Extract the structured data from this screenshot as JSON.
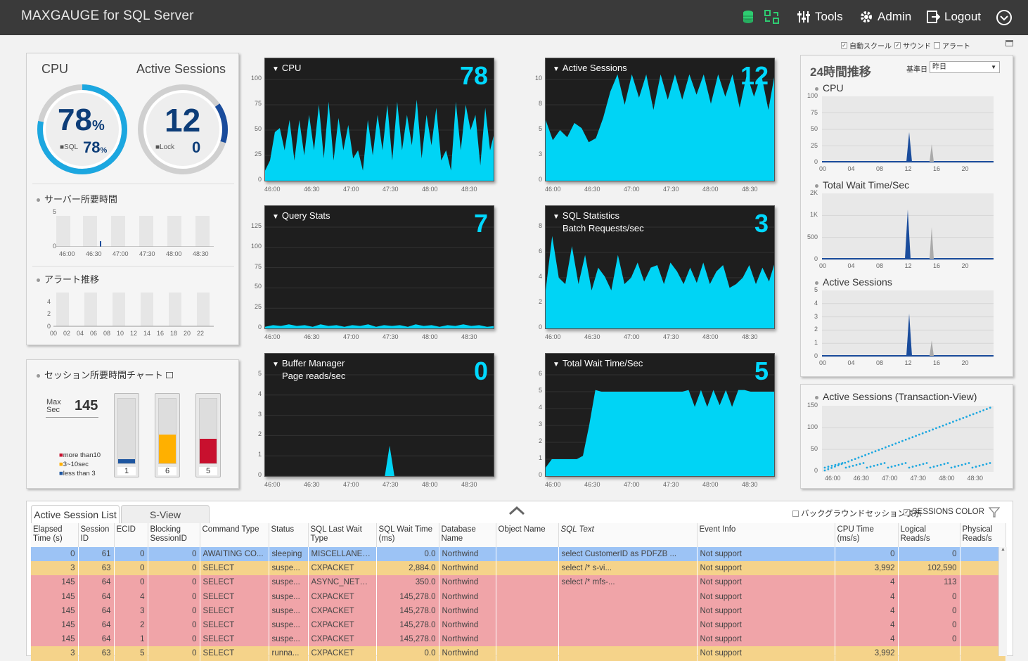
{
  "header": {
    "brand": "MAXGAUGE for SQL Server",
    "tools": "Tools",
    "admin": "Admin",
    "logout": "Logout"
  },
  "options": {
    "auto_scale": "自動スクール",
    "sound": "サウンド",
    "alert": "アラート"
  },
  "summary": {
    "cpu_label": "CPU",
    "cpu_value": "78",
    "cpu_unit": "%",
    "sql_label": "SQL",
    "sql_value": "78",
    "sql_unit": "%",
    "active_label": "Active Sessions",
    "active_value": "12",
    "lock_label": "Lock",
    "lock_value": "0",
    "server_time_title": "サーバー所要時間",
    "server_time_y": [
      "5",
      "0"
    ],
    "server_time_x": [
      "46:00",
      "46:30",
      "47:00",
      "47:30",
      "48:00",
      "48:30"
    ],
    "alert_title": "アラート推移",
    "alert_y": [
      "4",
      "2",
      "0"
    ],
    "alert_x": [
      "00",
      "02",
      "04",
      "06",
      "08",
      "10",
      "12",
      "14",
      "16",
      "18",
      "20",
      "22"
    ]
  },
  "session_chart": {
    "title": "セッション所要時間チャート",
    "max_label_1": "Max",
    "max_label_2": "Sec",
    "max_value": "145",
    "legend": [
      "more than10",
      "3~10sec",
      "less than 3"
    ],
    "bars": [
      {
        "count": "1",
        "fill": 0.06,
        "color": "#1e56a0"
      },
      {
        "count": "6",
        "fill": 0.45,
        "color": "#ffb000"
      },
      {
        "count": "5",
        "fill": 0.38,
        "color": "#c8102e"
      }
    ]
  },
  "x_axis": [
    "46:00",
    "46:30",
    "47:00",
    "47:30",
    "48:00",
    "48:30"
  ],
  "charts": {
    "cpu": {
      "title": "CPU",
      "value": "78",
      "y": [
        "100",
        "75",
        "50",
        "25",
        "0"
      ]
    },
    "active": {
      "title": "Active Sessions",
      "value": "12",
      "y": [
        "10",
        "8",
        "5",
        "3",
        "0"
      ]
    },
    "query": {
      "title": "Query Stats",
      "value": "7",
      "y": [
        "125",
        "100",
        "75",
        "50",
        "25",
        "0"
      ]
    },
    "sqlstat": {
      "title": "SQL Statistics",
      "subtitle": "Batch Requests/sec",
      "value": "3",
      "y": [
        "8",
        "6",
        "4",
        "2",
        "0"
      ]
    },
    "buffer": {
      "title": "Buffer Manager",
      "subtitle": "Page reads/sec",
      "value": "0",
      "y": [
        "5",
        "4",
        "3",
        "2",
        "1",
        "0"
      ]
    },
    "wait": {
      "title": "Total Wait Time/Sec",
      "value": "5",
      "y": [
        "6",
        "5",
        "4",
        "3",
        "2",
        "1",
        "0"
      ]
    }
  },
  "trend": {
    "title": "24時間推移",
    "base_label": "基準日",
    "base_value": "昨日",
    "x": [
      "00",
      "04",
      "08",
      "12",
      "16",
      "20"
    ],
    "cpu": {
      "title": "CPU",
      "y": [
        "100",
        "75",
        "50",
        "25",
        "0"
      ]
    },
    "wait": {
      "title": "Total Wait Time/Sec",
      "y": [
        "2K",
        "1K",
        "500",
        "0"
      ]
    },
    "active": {
      "title": "Active Sessions",
      "y": [
        "5",
        "4",
        "3",
        "2",
        "1",
        "0"
      ]
    }
  },
  "txview": {
    "title": "Active Sessions (Transaction-View)",
    "y": [
      "150",
      "100",
      "50",
      "0"
    ],
    "x": [
      "46:00",
      "46:30",
      "47:00",
      "47:30",
      "48:00",
      "48:30"
    ]
  },
  "list": {
    "tab1": "Active Session List",
    "tab2": "S-View",
    "bg_label": "バックグラウンドセッション表示",
    "color_label": "SESSIONS COLOR",
    "columns": [
      "Elapsed Time (s)",
      "Session ID",
      "ECID",
      "Blocking SessionID",
      "Command Type",
      "Status",
      "SQL Last Wait Type",
      "SQL Wait Time (ms)",
      "Database Name",
      "Object Name",
      "SQL Text",
      "Event Info",
      "CPU Time (ms/s)",
      "Logical Reads/s",
      "Physical Reads/s"
    ],
    "rows": [
      {
        "color": "#9cc3f5",
        "cells": [
          "0",
          "61",
          "0",
          "0",
          "AWAITING CO...",
          "sleeping",
          "MISCELLANEO...",
          "0.0",
          "Northwind",
          "",
          "select CustomerID as PDFZB ...",
          "Not support",
          "0",
          "0",
          ""
        ]
      },
      {
        "color": "#f5d38a",
        "cells": [
          "3",
          "63",
          "0",
          "0",
          "SELECT",
          "suspe...",
          "CXPACKET",
          "2,884.0",
          "Northwind",
          "",
          "select /* s-vi...",
          "Not support",
          "3,992",
          "102,590",
          ""
        ]
      },
      {
        "color": "#f0a4a8",
        "cells": [
          "145",
          "64",
          "0",
          "0",
          "SELECT",
          "suspe...",
          "ASYNC_NETW...",
          "350.0",
          "Northwind",
          "",
          "select /* mfs-...",
          "Not support",
          "4",
          "113",
          ""
        ]
      },
      {
        "color": "#f0a4a8",
        "cells": [
          "145",
          "64",
          "4",
          "0",
          "SELECT",
          "suspe...",
          "CXPACKET",
          "145,278.0",
          "Northwind",
          "",
          "",
          "Not support",
          "4",
          "0",
          ""
        ]
      },
      {
        "color": "#f0a4a8",
        "cells": [
          "145",
          "64",
          "3",
          "0",
          "SELECT",
          "suspe...",
          "CXPACKET",
          "145,278.0",
          "Northwind",
          "",
          "",
          "Not support",
          "4",
          "0",
          ""
        ]
      },
      {
        "color": "#f0a4a8",
        "cells": [
          "145",
          "64",
          "2",
          "0",
          "SELECT",
          "suspe...",
          "CXPACKET",
          "145,278.0",
          "Northwind",
          "",
          "",
          "Not support",
          "4",
          "0",
          ""
        ]
      },
      {
        "color": "#f0a4a8",
        "cells": [
          "145",
          "64",
          "1",
          "0",
          "SELECT",
          "suspe...",
          "CXPACKET",
          "145,278.0",
          "Northwind",
          "",
          "",
          "Not support",
          "4",
          "0",
          ""
        ]
      },
      {
        "color": "#f5d38a",
        "cells": [
          "3",
          "63",
          "5",
          "0",
          "SELECT",
          "runna...",
          "CXPACKET",
          "0.0",
          "Northwind",
          "",
          "",
          "Not support",
          "3,992",
          "",
          ""
        ]
      }
    ]
  }
}
